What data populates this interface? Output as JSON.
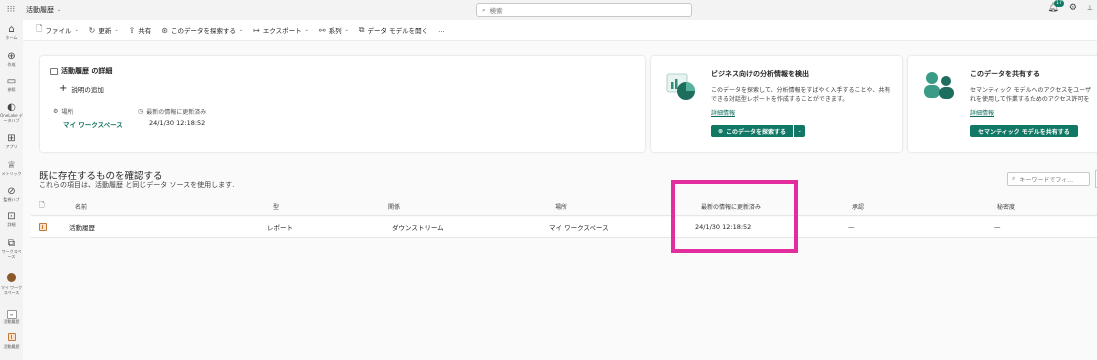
{
  "app": {
    "title": "活動履歴"
  },
  "search": {
    "placeholder": "検索"
  },
  "notifications": {
    "count": "17"
  },
  "leftnav": [
    {
      "label": "ホーム",
      "icon": "home-icon"
    },
    {
      "label": "作成",
      "icon": "create-icon"
    },
    {
      "label": "参照",
      "icon": "browse-icon"
    },
    {
      "label": "OneLake データハブ",
      "icon": "onelake-icon"
    },
    {
      "label": "アプリ",
      "icon": "apps-icon"
    },
    {
      "label": "メトリック",
      "icon": "metrics-icon"
    },
    {
      "label": "監視ハブ",
      "icon": "monitor-icon"
    },
    {
      "label": "詳細",
      "icon": "learn-icon"
    },
    {
      "label": "ワークスペース",
      "icon": "workspaces-icon"
    },
    {
      "label": "マイ ワークスペース",
      "icon": "my-workspace-avatar"
    },
    {
      "label": "活動履歴",
      "icon": "dataset-icon"
    },
    {
      "label": "活動履歴",
      "icon": "report-icon"
    }
  ],
  "toolbar": {
    "file": "ファイル",
    "refresh": "更新",
    "share": "共有",
    "explore": "このデータを探索する",
    "export": "エクスポート",
    "lineage": "系列",
    "open_model": "データ モデルを開く",
    "more": "…"
  },
  "details_card": {
    "title": "活動履歴 の詳細",
    "add_description": "説明の追加",
    "location_label": "場所",
    "location_value": "マイ ワークスペース",
    "updated_label": "最新の情報に更新済み",
    "updated_value": "24/1/30 12:18:52"
  },
  "insight_card": {
    "title": "ビジネス向けの分析情報を検出",
    "description": "このデータを探索して、分析情報をすばやく入手することや、共有できる対話型レポートを作成することができます。",
    "link": "詳細情報",
    "button": "このデータを探索する"
  },
  "share_card": {
    "title": "このデータを共有する",
    "description_line1": "セマンティック モデルへのアクセスをユーザ",
    "description_line2": "れを使用して作業するためのアクセス許可を",
    "link": "詳細情報",
    "button": "セマンティック モデルを共有する"
  },
  "section": {
    "title": "既に存在するものを確認する",
    "subtitle": "これらの項目は、活動履歴 と同じデータ ソースを使用します.",
    "filter_placeholder": "キーワードでフィ..."
  },
  "table": {
    "headers": {
      "name": "名前",
      "type": "型",
      "relation": "関係",
      "location": "場所",
      "updated": "最新の情報に更新済み",
      "endorsement": "承認",
      "sensitivity": "秘密度"
    },
    "rows": [
      {
        "name": "活動履歴",
        "type": "レポート",
        "relation": "ダウンストリーム",
        "location": "マイ ワークスペース",
        "updated": "24/1/30 12:18:52",
        "endorsement": "—",
        "sensitivity": "—"
      }
    ]
  },
  "colors": {
    "accent": "#117865",
    "link": "#0f6d5f",
    "highlight": "#e22d9e"
  }
}
